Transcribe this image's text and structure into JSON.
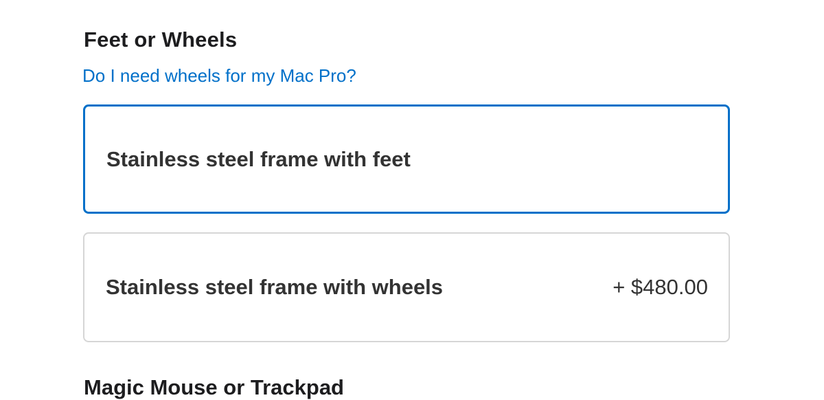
{
  "section": {
    "title": "Feet or Wheels",
    "help_link": "Do I need wheels for my Mac Pro?"
  },
  "options": [
    {
      "label": "Stainless steel frame with feet",
      "price": "",
      "selected": true
    },
    {
      "label": "Stainless steel frame with wheels",
      "price": "+ $480.00",
      "selected": false
    }
  ],
  "next_section": {
    "title": "Magic Mouse or Trackpad"
  },
  "colors": {
    "accent": "#0070c9",
    "border": "#d6d6d6",
    "text": "#333333",
    "heading": "#1d1d1f"
  }
}
